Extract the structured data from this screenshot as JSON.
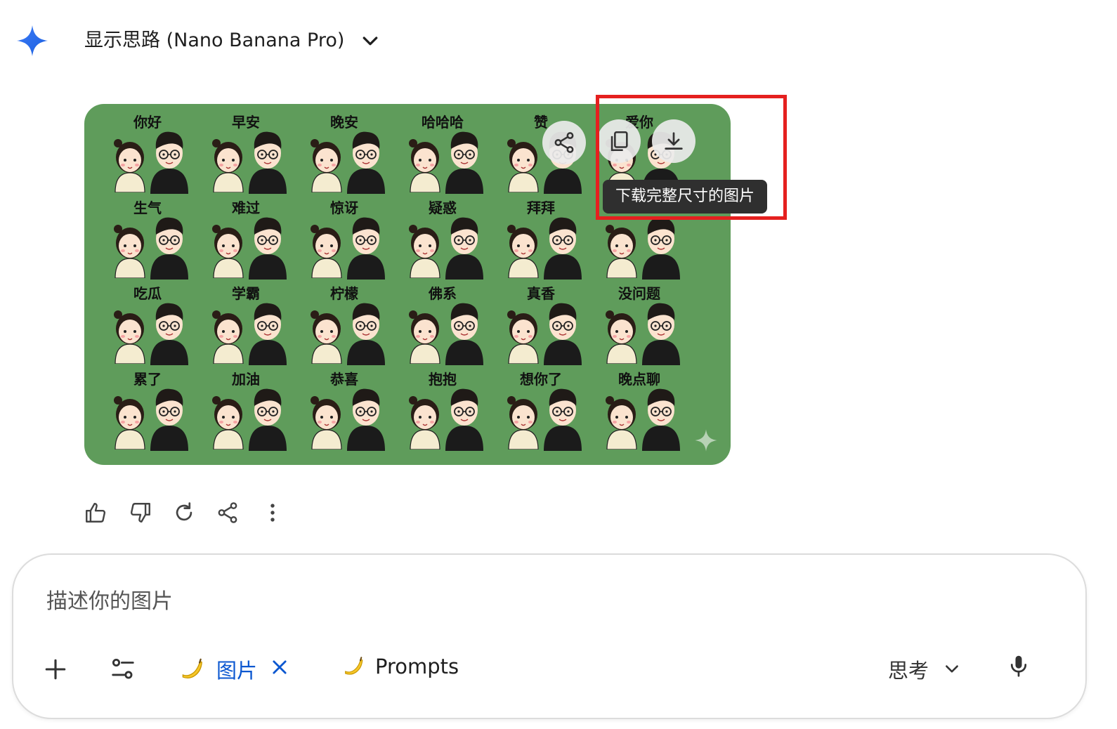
{
  "header": {
    "title": "显示思路 (Nano Banana Pro)",
    "icons": {
      "logo": "gemini-sparkle-icon",
      "expand": "chevron-down-icon"
    }
  },
  "sticker_sheet": {
    "labels": [
      [
        "你好",
        "早安",
        "晚安",
        "哈哈哈",
        "赞",
        "爱你"
      ],
      [
        "生气",
        "难过",
        "惊讶",
        "疑惑",
        "拜拜",
        ""
      ],
      [
        "吃瓜",
        "学霸",
        "柠檬",
        "佛系",
        "真香",
        "没问题"
      ],
      [
        "累了",
        "加油",
        "恭喜",
        "抱抱",
        "想你了",
        "晚点聊"
      ]
    ],
    "overlay_buttons": [
      "share-icon",
      "copy-icon",
      "download-icon"
    ],
    "tooltip": "下载完整尺寸的图片"
  },
  "actions": [
    "thumb-up-icon",
    "thumb-down-icon",
    "redo-icon",
    "share-icon",
    "more-vert-icon"
  ],
  "composer": {
    "placeholder": "描述你的图片",
    "chip_image_label": "图片",
    "prompts_label": "Prompts",
    "mode_label": "思考",
    "icons": [
      "plus-icon",
      "tune-icon",
      "banana-icon",
      "close-icon",
      "microphone-icon"
    ]
  },
  "colors": {
    "sheet_bg": "#5f9c5b",
    "accent_blue": "#0b57d0",
    "highlight_red": "#e5201f",
    "tooltip_bg": "#2f2f2f"
  }
}
